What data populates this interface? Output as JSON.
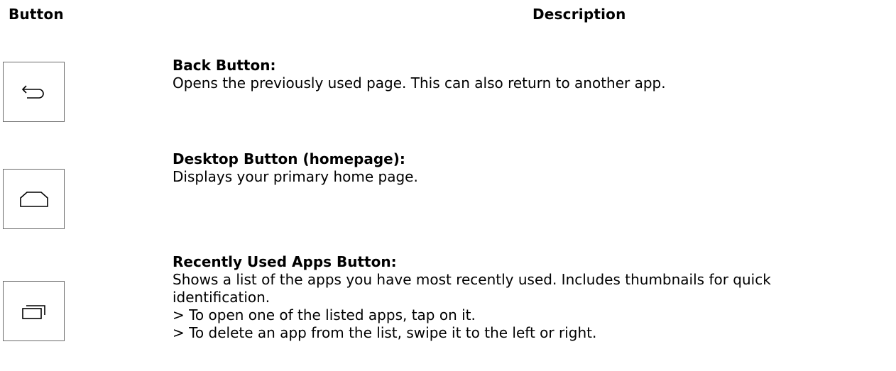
{
  "header": {
    "button_col": "Button",
    "description_col": "Description"
  },
  "rows": [
    {
      "icon": "back-arrow-icon",
      "title": "Back Button:",
      "lines": [
        "Opens the previously used page. This can also return to another app."
      ]
    },
    {
      "icon": "home-icon",
      "title": "Desktop Button (homepage):",
      "lines": [
        "Displays your primary home page."
      ]
    },
    {
      "icon": "recent-apps-icon",
      "title": "Recently Used Apps Button:",
      "lines": [
        "Shows a list of the apps you have most recently used. Includes thumbnails for quick",
        "identification.",
        "> To open one of the listed apps, tap on it.",
        "> To delete an app from the list, swipe it to the left or right."
      ]
    }
  ],
  "colors": {
    "text": "#000000",
    "border": "#6a6a6a"
  }
}
